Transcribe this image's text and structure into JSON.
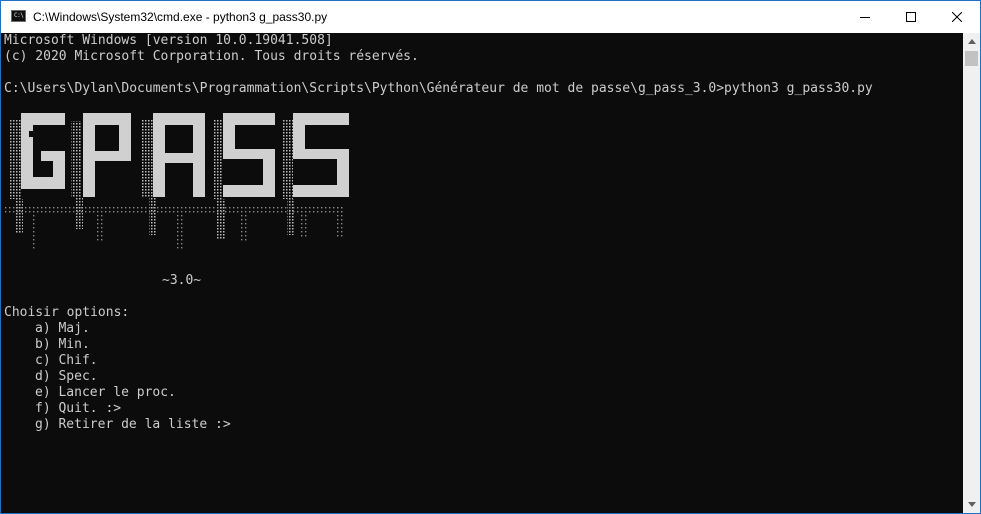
{
  "window": {
    "title": "C:\\Windows\\System32\\cmd.exe - python3  g_pass30.py",
    "icon_label": "C:\\"
  },
  "terminal": {
    "lines": [
      "Microsoft Windows [version 10.0.19041.508]",
      "(c) 2020 Microsoft Corporation. Tous droits réservés.",
      "",
      "C:\\Users\\Dylan\\Documents\\Programmation\\Scripts\\Python\\Générateur de mot de passe\\g_pass_3.0>python3 g_pass30.py"
    ],
    "banner": {
      "logo_text": "GPASS",
      "version": "~3.0~"
    },
    "menu": {
      "header": "Choisir options:",
      "options": [
        "a) Maj.",
        "b) Min.",
        "c) Chif.",
        "d) Spec.",
        "e) Lancer le proc.",
        "f) Quit. :>",
        "g) Retirer de la liste :>"
      ]
    }
  },
  "colors": {
    "terminal_bg": "#0c0c0c",
    "terminal_fg": "#cccccc",
    "title_bar_bg": "#ffffff",
    "window_border": "#1f6fc4"
  },
  "icons": [
    "cmd-app-icon",
    "minimize-icon",
    "maximize-icon",
    "close-icon",
    "scroll-up-icon",
    "scroll-down-icon"
  ]
}
